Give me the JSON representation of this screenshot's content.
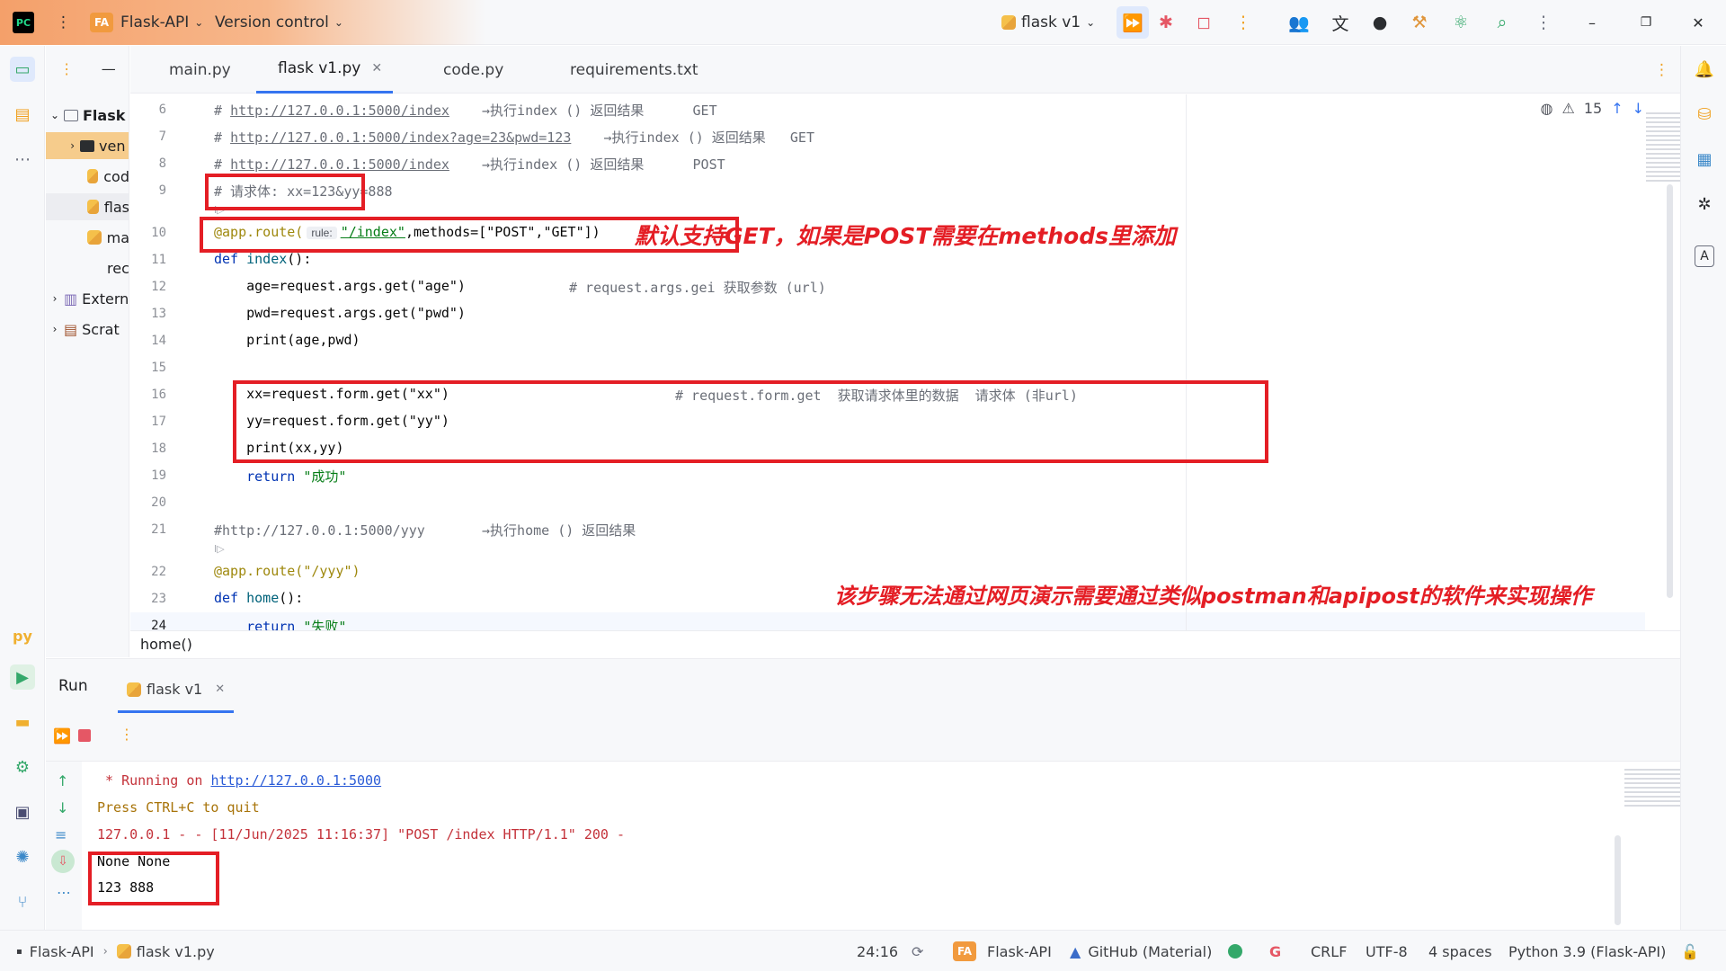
{
  "titlebar": {
    "app_logo": "PC",
    "project_badge": "FA",
    "project_name": "Flask-API",
    "version_control": "Version control",
    "run_config": "flask v1"
  },
  "left_strip": {
    "icons": [
      "project-icon",
      "structure-icon",
      "more-icon",
      "python-console-icon",
      "run-icon",
      "bookmarks-icon",
      "services-icon",
      "terminal-icon",
      "problems-icon",
      "git-icon",
      "more-icon"
    ],
    "py_label": "py"
  },
  "project_panel": {
    "items": [
      {
        "label": "Flask",
        "kind": "root"
      },
      {
        "label": "ven",
        "kind": "folder"
      },
      {
        "label": "cod",
        "kind": "py"
      },
      {
        "label": "flas",
        "kind": "py"
      },
      {
        "label": "ma",
        "kind": "py"
      },
      {
        "label": "rec",
        "kind": "txt"
      },
      {
        "label": "Extern",
        "kind": "libs"
      },
      {
        "label": "Scrat",
        "kind": "scratch"
      }
    ]
  },
  "tabs": [
    {
      "label": "main.py",
      "active": false
    },
    {
      "label": "flask v1.py",
      "active": true
    },
    {
      "label": "code.py",
      "active": false
    },
    {
      "label": "requirements.txt",
      "active": false
    }
  ],
  "editor": {
    "warnings_count": "15",
    "lines": {
      "n6": "6",
      "n7": "7",
      "n8": "8",
      "n9": "9",
      "n10": "10",
      "n11": "11",
      "n12": "12",
      "n13": "13",
      "n14": "14",
      "n15": "15",
      "n16": "16",
      "n17": "17",
      "n18": "18",
      "n19": "19",
      "n20": "20",
      "n21": "21",
      "n22": "22",
      "n23": "23",
      "n24": "24"
    },
    "code": {
      "l6_url": "http://127.0.0.1:5000/index",
      "l6_rest": "    →执行index () 返回结果      GET",
      "l7_url": "http://127.0.0.1:5000/index?age=23&pwd=123",
      "l7_rest": "    →执行index () 返回结果   GET",
      "l8_url": "http://127.0.0.1:5000/index",
      "l8_rest": "    →执行index () 返回结果      POST",
      "l9": "# 请求体: xx=123&yy=888",
      "hint9": "Ⅰ▷",
      "l10_deco": "@app.route(",
      "l10_rule": "rule:",
      "l10_path": "\"/index\"",
      "l10_methods": ",methods=[\"POST\",\"GET\"])",
      "l11_def": "def ",
      "l11_name": "index",
      "l11_rest": "():",
      "l12_code": "    age=request.args.get(\"age\")",
      "l12_comment": "# request.args.gei 获取参数 (url)",
      "l13": "    pwd=request.args.get(\"pwd\")",
      "l14": "    print(age,pwd)",
      "l16_code": "    xx=request.form.get(\"xx\")",
      "l16_comment": "# request.form.get  获取请求体里的数据  请求体 (非url)",
      "l17": "    yy=request.form.get(\"yy\")",
      "l18": "    print(xx,yy)",
      "l19_kw": "    return ",
      "l19_str": "\"成功\"",
      "l21": "#http://127.0.0.1:5000/yyy       →执行home () 返回结果",
      "hint21": "Ⅰ▷",
      "l22": "@app.route(\"/yyy\")",
      "l23_def": "def ",
      "l23_name": "home",
      "l23_rest": "():",
      "l24_kw": "    return ",
      "l24_str": "\"失败\""
    },
    "annotation_1": "默认支持GET，如果是POST需要在methods里添加",
    "annotation_2": "该步骤无法通过网页演示需要通过类似postman和apipost的软件来实现操作"
  },
  "breadcrumb": "home()",
  "run_panel": {
    "title": "Run",
    "tab": "flask v1",
    "console": {
      "l1_prefix": " * Running on ",
      "l1_link": "http://127.0.0.1:5000",
      "l2": "Press CTRL+C to quit",
      "l3": "127.0.0.1 - - [11/Jun/2025 11:16:37] \"POST /index HTTP/1.1\" 200 -",
      "l4": "None None",
      "l5": "123 888"
    }
  },
  "statusbar": {
    "project": "Flask-API",
    "file": "flask v1.py",
    "position": "24:16",
    "badge": "FA",
    "project2": "Flask-API",
    "theme": "GitHub (Material)",
    "line_sep": "CRLF",
    "encoding": "UTF-8",
    "indent": "4 spaces",
    "interpreter": "Python 3.9 (Flask-API)"
  },
  "colors": {
    "accent": "#3574f0",
    "highlight_red": "#e41e25",
    "project_orange": "#f19a3e"
  }
}
